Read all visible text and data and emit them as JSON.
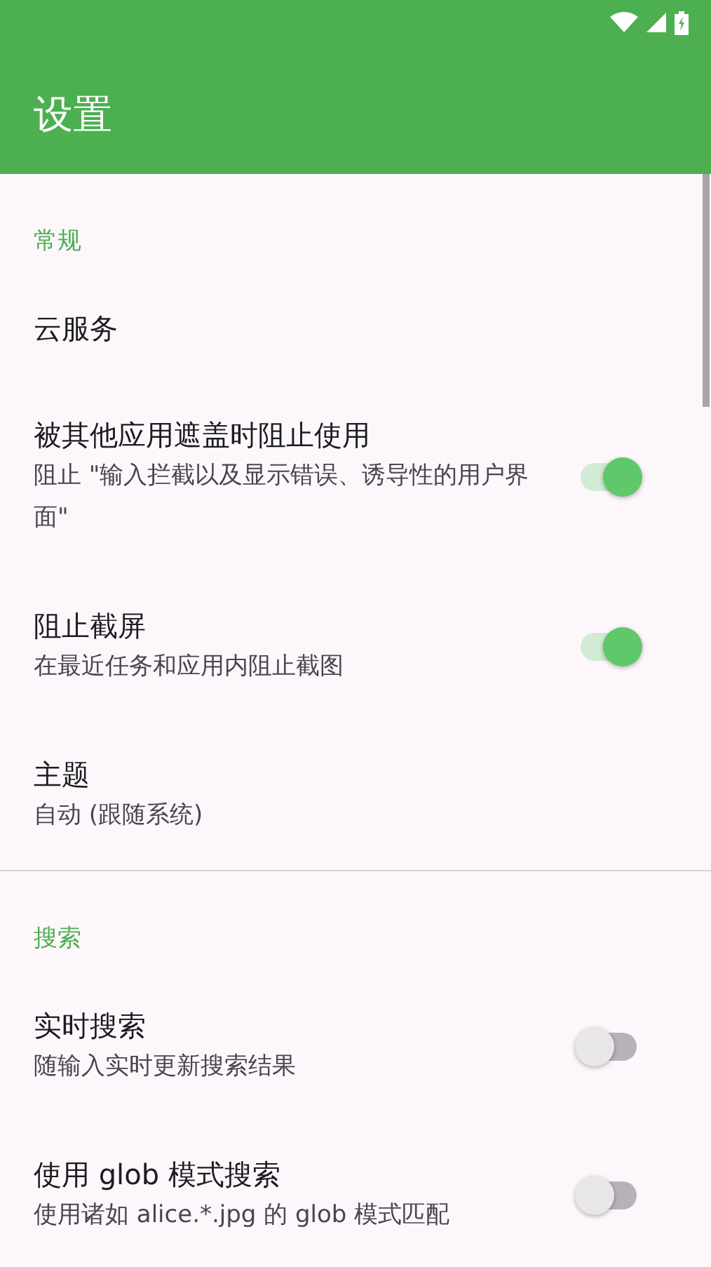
{
  "app_bar": {
    "title": "设置"
  },
  "sections": [
    {
      "title": "常规",
      "items": [
        {
          "kind": "plain",
          "title": "云服务"
        },
        {
          "kind": "switch",
          "title": "被其他应用遮盖时阻止使用",
          "summary": "阻止 \"输入拦截以及显示错误、诱导性的用户界面\"",
          "on": true
        },
        {
          "kind": "switch",
          "title": "阻止截屏",
          "summary": "在最近任务和应用内阻止截图",
          "on": true
        },
        {
          "kind": "plain",
          "title": "主题",
          "summary": "自动 (跟随系统)"
        }
      ]
    },
    {
      "title": "搜索",
      "items": [
        {
          "kind": "switch",
          "title": "实时搜索",
          "summary": "随输入实时更新搜索结果",
          "on": false
        },
        {
          "kind": "switch",
          "title": "使用 glob 模式搜索",
          "summary": "使用诸如 alice.*.jpg 的 glob 模式匹配",
          "on": false
        }
      ]
    }
  ]
}
